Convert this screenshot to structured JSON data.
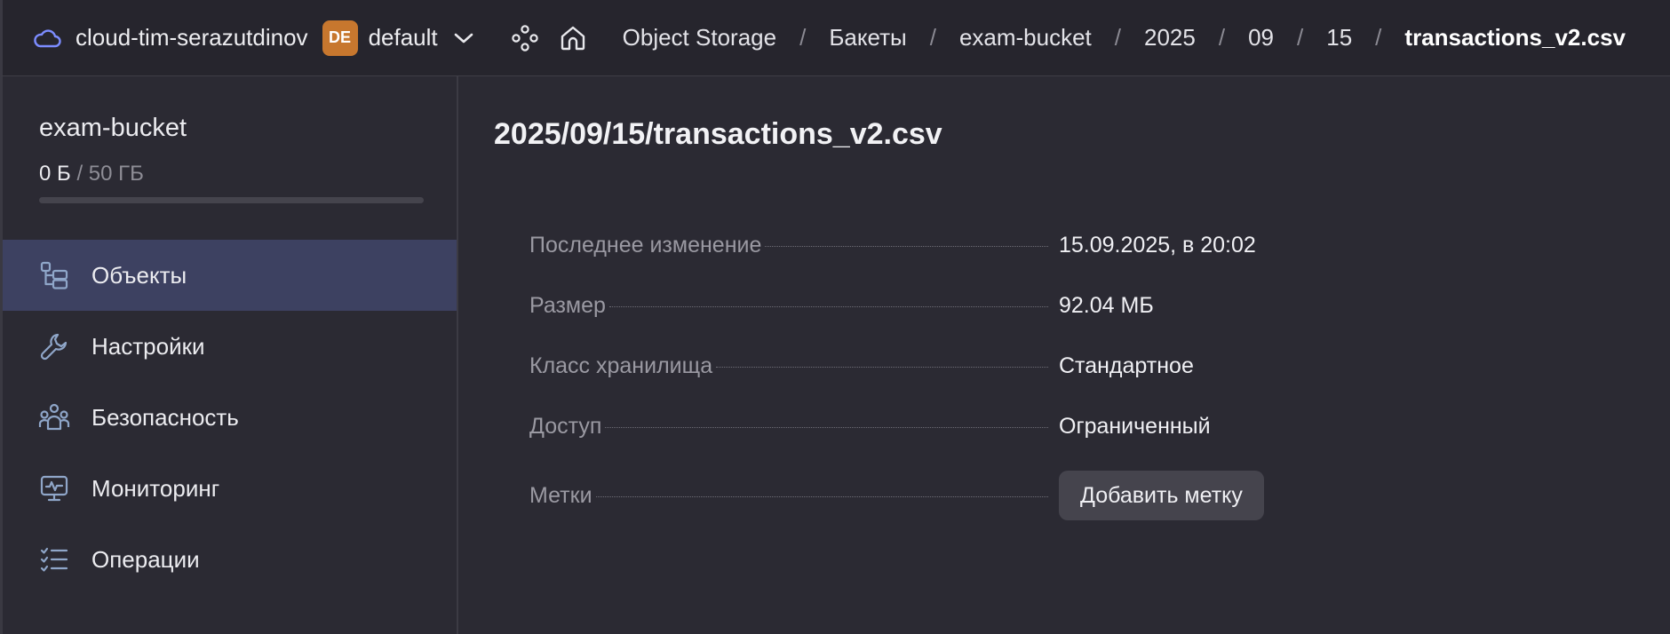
{
  "header": {
    "account": "cloud-tim-serazutdinov",
    "folder_badge": "DE",
    "folder": "default",
    "breadcrumbs": [
      "Object Storage",
      "Бакеты",
      "exam-bucket",
      "2025",
      "09",
      "15",
      "transactions_v2.csv"
    ],
    "separator": "/"
  },
  "sidebar": {
    "bucket_name": "exam-bucket",
    "usage_used": "0 Б",
    "usage_total": "/ 50 ГБ",
    "usage_fraction": 0,
    "items": [
      {
        "label": "Объекты",
        "icon": "objects-icon",
        "active": true
      },
      {
        "label": "Настройки",
        "icon": "wrench-icon",
        "active": false
      },
      {
        "label": "Безопасность",
        "icon": "users-icon",
        "active": false
      },
      {
        "label": "Мониторинг",
        "icon": "monitor-icon",
        "active": false
      },
      {
        "label": "Операции",
        "icon": "operations-list-icon",
        "active": false
      }
    ]
  },
  "main": {
    "title": "2025/09/15/transactions_v2.csv",
    "properties": [
      {
        "label": "Последнее изменение",
        "value": "15.09.2025, в 20:02"
      },
      {
        "label": "Размер",
        "value": "92.04 МБ"
      },
      {
        "label": "Класс хранилища",
        "value": "Стандартное"
      },
      {
        "label": "Доступ",
        "value": "Ограниченный"
      }
    ],
    "tags_label": "Метки",
    "add_tag_button": "Добавить метку"
  },
  "colors": {
    "accent": "#7c8cff",
    "active_nav": "#3d4161",
    "badge": "#c7772e",
    "background": "#2b2a33"
  }
}
